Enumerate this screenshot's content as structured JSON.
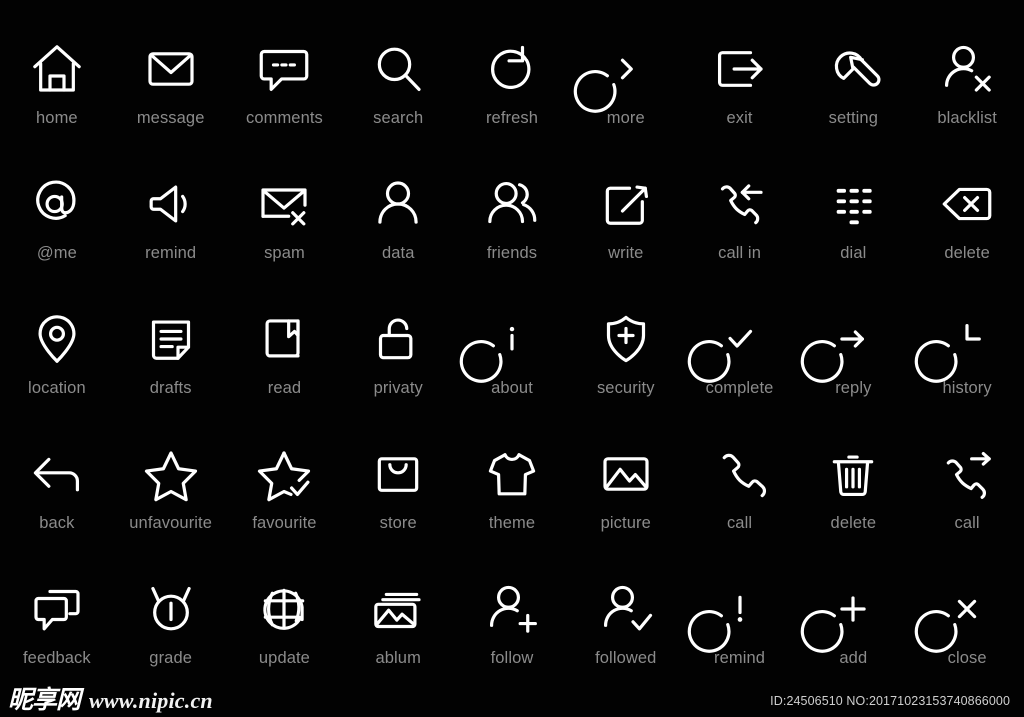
{
  "page": {
    "background_color": "#020202",
    "icon_stroke_color": "#ffffff",
    "label_color": "#8b8b8b",
    "columns": 9,
    "rows": 5,
    "total_icons": 45
  },
  "icons": [
    {
      "label": "home",
      "icon": "home-icon"
    },
    {
      "label": "message",
      "icon": "envelope-icon"
    },
    {
      "label": "comments",
      "icon": "speech-bubble-dots-icon"
    },
    {
      "label": "search",
      "icon": "magnifier-icon"
    },
    {
      "label": "refresh",
      "icon": "refresh-arrow-icon"
    },
    {
      "label": "more",
      "icon": "circle-chevron-right-icon"
    },
    {
      "label": "exit",
      "icon": "exit-arrow-icon"
    },
    {
      "label": "setting",
      "icon": "wrench-icon"
    },
    {
      "label": "blacklist",
      "icon": "user-x-icon"
    },
    {
      "label": "@me",
      "icon": "at-circle-icon"
    },
    {
      "label": "remind",
      "icon": "speaker-icon"
    },
    {
      "label": "spam",
      "icon": "envelope-x-icon"
    },
    {
      "label": "data",
      "icon": "user-icon"
    },
    {
      "label": "friends",
      "icon": "users-icon"
    },
    {
      "label": "write",
      "icon": "pencil-square-icon"
    },
    {
      "label": "call in",
      "icon": "phone-incoming-icon"
    },
    {
      "label": "dial",
      "icon": "keypad-icon"
    },
    {
      "label": "delete",
      "icon": "backspace-x-icon"
    },
    {
      "label": "location",
      "icon": "map-pin-icon"
    },
    {
      "label": "drafts",
      "icon": "document-lines-icon"
    },
    {
      "label": "read",
      "icon": "book-bookmark-icon"
    },
    {
      "label": "privaty",
      "icon": "unlock-icon"
    },
    {
      "label": "about",
      "icon": "circle-info-icon"
    },
    {
      "label": "security",
      "icon": "shield-plus-icon"
    },
    {
      "label": "complete",
      "icon": "circle-check-icon"
    },
    {
      "label": "reply",
      "icon": "circle-arrow-right-icon"
    },
    {
      "label": "history",
      "icon": "clock-icon"
    },
    {
      "label": "back",
      "icon": "arrow-left-return-icon"
    },
    {
      "label": "unfavourite",
      "icon": "star-outline-icon"
    },
    {
      "label": "favourite",
      "icon": "star-check-icon"
    },
    {
      "label": "store",
      "icon": "shopping-bag-icon"
    },
    {
      "label": "theme",
      "icon": "tshirt-icon"
    },
    {
      "label": "picture",
      "icon": "image-mountain-icon"
    },
    {
      "label": "call",
      "icon": "phone-handset-icon"
    },
    {
      "label": "delete",
      "icon": "trash-can-icon"
    },
    {
      "label": "call",
      "icon": "phone-outgoing-icon"
    },
    {
      "label": "feedback",
      "icon": "double-chat-bubble-icon"
    },
    {
      "label": "grade",
      "icon": "medal-icon"
    },
    {
      "label": "update",
      "icon": "globe-grid-icon"
    },
    {
      "label": "ablum",
      "icon": "image-stack-icon"
    },
    {
      "label": "follow",
      "icon": "user-plus-icon"
    },
    {
      "label": "followed",
      "icon": "user-check-icon"
    },
    {
      "label": "remind",
      "icon": "circle-exclamation-icon"
    },
    {
      "label": "add",
      "icon": "circle-plus-icon"
    },
    {
      "label": "close",
      "icon": "circle-x-icon"
    }
  ],
  "footer": {
    "watermark_cn": "昵享网",
    "watermark_url": "www.nipic.cn",
    "id_text": "ID:24506510 NO:20171023153740866000"
  }
}
